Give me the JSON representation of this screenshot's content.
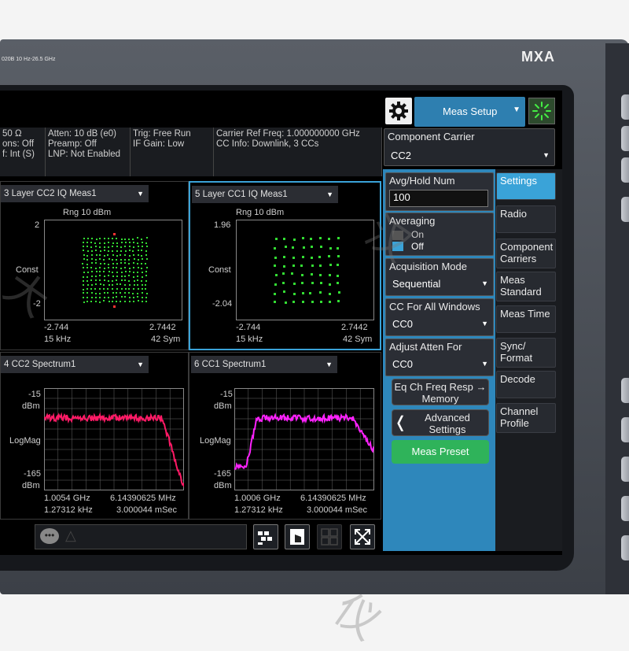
{
  "device": {
    "brand": "MXA",
    "model_text": "020B  10 Hz-26.5 GHz"
  },
  "header": {
    "meas_setup_label": "Meas Setup"
  },
  "info_bar": {
    "col1": "50 Ω\nons: Off\nf: Int (S)",
    "col2": "Atten: 10 dB (e0)\nPreamp: Off\nLNP: Not Enabled",
    "col3": "Trig: Free Run\nIF Gain: Low",
    "col4": "Carrier Ref Freq: 1.000000000 GHz\nCC Info: Downlink, 3 CCs"
  },
  "windows": [
    {
      "title": "3 Layer CC2 IQ Meas1",
      "rng": "Rng 10 dBm",
      "y_top": "2",
      "y_mid": "Const",
      "y_bot": "-2",
      "x_left": "-2.744",
      "x_right": "2.7442",
      "x_left2": "15 kHz",
      "x_right2": "42  Sym"
    },
    {
      "title": "5 Layer CC1 IQ Meas1",
      "rng": "Rng 10 dBm",
      "y_top": "1.96",
      "y_mid": "Const",
      "y_bot": "-2.04",
      "x_left": "-2.744",
      "x_right": "2.7442",
      "x_left2": "15 kHz",
      "x_right2": "42  Sym"
    },
    {
      "title": "4 CC2 Spectrum1",
      "y_top": "-15",
      "y_top_unit": "dBm",
      "y_mid": "LogMag",
      "y_bot": "-165",
      "y_bot_unit": "dBm",
      "x_left": "1.0054 GHz",
      "x_right": "6.14390625 MHz",
      "x_left2": "1.27312 kHz",
      "x_right2": "3.000044 mSec"
    },
    {
      "title": "6 CC1 Spectrum1",
      "y_top": "-15",
      "y_top_unit": "dBm",
      "y_mid": "LogMag",
      "y_bot": "-165",
      "y_bot_unit": "dBm",
      "x_left": "1.0006 GHz",
      "x_right": "6.14390625 MHz",
      "x_left2": "1.27312 kHz",
      "x_right2": "3.000044 mSec"
    }
  ],
  "panel": {
    "component_carrier": {
      "label": "Component Carrier",
      "value": "CC2"
    },
    "avg_hold": {
      "label": "Avg/Hold Num",
      "value": "100"
    },
    "averaging": {
      "label": "Averaging",
      "on": "On",
      "off": "Off"
    },
    "acq_mode": {
      "label": "Acquisition Mode",
      "value": "Sequential"
    },
    "cc_all": {
      "label": "CC For All Windows",
      "value": "CC0"
    },
    "adj_atten": {
      "label": "Adjust Atten For",
      "value": "CC0"
    },
    "eq_ch": {
      "line1": "Eq Ch Freq Resp →",
      "line2": "Memory"
    },
    "advanced": {
      "line1": "Advanced",
      "line2": "Settings"
    },
    "meas_preset": "Meas Preset"
  },
  "menu": [
    {
      "label": "Settings"
    },
    {
      "label": "Radio"
    },
    {
      "label": "Component\nCarriers"
    },
    {
      "label": "Meas\nStandard"
    },
    {
      "label": "Meas Time"
    },
    {
      "label": "Sync/\nFormat"
    },
    {
      "label": "Decode"
    },
    {
      "label": "Channel\nProfile"
    }
  ],
  "colors": {
    "accent": "#3aa3d8",
    "constellation": "#33dd33",
    "spectrum_cc2": "#ff1a66",
    "spectrum_cc1": "#ff22ff",
    "preset": "#2fb35a"
  },
  "icons": [
    "gear-icon",
    "chevron-down-icon",
    "status-spinner-icon",
    "chat-icon",
    "chevron-left-icon",
    "layout-icon",
    "touch-icon",
    "grid-icon",
    "expand-icon"
  ]
}
